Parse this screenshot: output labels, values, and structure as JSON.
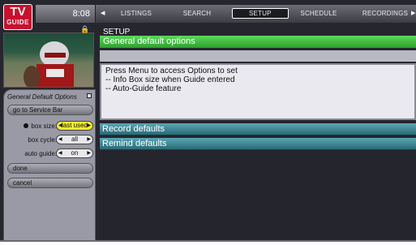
{
  "logo": {
    "line1": "TV",
    "line2": "GUIDE"
  },
  "clock": "8:08",
  "nav": {
    "items": [
      "LISTINGS",
      "SEARCH",
      "SETUP",
      "SCHEDULE",
      "RECORDINGS"
    ],
    "selected": "SETUP",
    "left_arrow": "◀",
    "right_arrow": "▶"
  },
  "left_panel": {
    "title": "General Default Options",
    "go_to_service_bar": "go to Service Bar",
    "box_size": {
      "label": "box size:",
      "value": "last used"
    },
    "box_cycle": {
      "label": "box cycle:",
      "value": "all"
    },
    "auto_guide": {
      "label": "auto guide:",
      "value": "on"
    },
    "done": "done",
    "cancel": "cancel"
  },
  "content": {
    "section_label": "SETUP",
    "header": "General default options",
    "description_lines": [
      "Press Menu to access Options to set",
      "-- Info Box size when Guide entered",
      "-- Auto-Guide feature"
    ],
    "record_defaults": "Record defaults",
    "remind_defaults": "Remind defaults"
  },
  "colors": {
    "accent_green": "#3cc23c",
    "teal": "#3e8a96",
    "logo_red": "#c8102e",
    "highlight_yellow": "#f5ec30"
  }
}
